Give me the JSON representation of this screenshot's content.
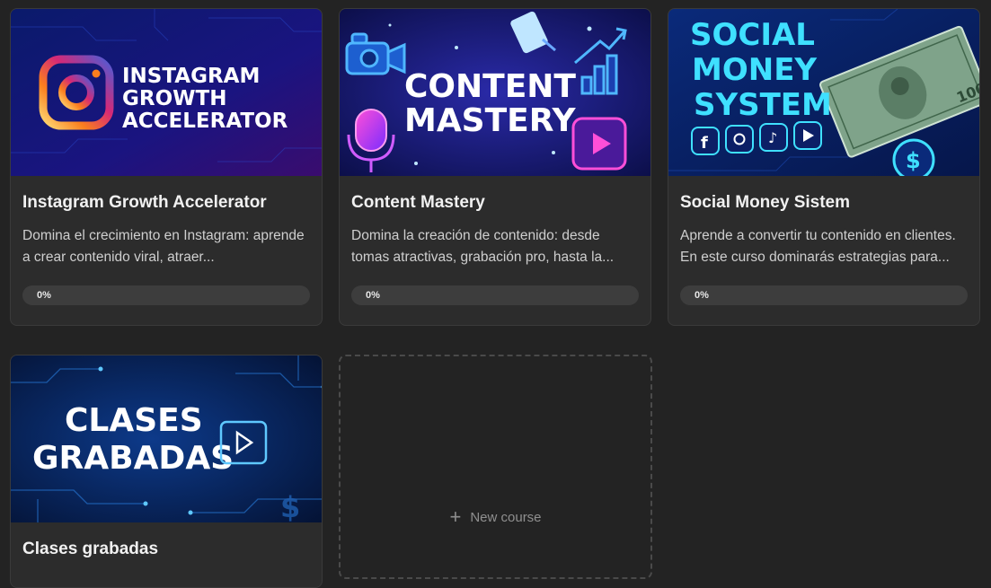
{
  "courses": [
    {
      "title": "Instagram Growth Accelerator",
      "description": "Domina el crecimiento en Instagram: aprende a crear contenido viral, atraer...",
      "progress_label": "0%",
      "progress": 0,
      "thumb_text": [
        "INSTAGRAM",
        "GROWTH",
        "ACCELERATOR"
      ]
    },
    {
      "title": "Content Mastery",
      "description": "Domina la creación de contenido: desde tomas atractivas, grabación pro, hasta la...",
      "progress_label": "0%",
      "progress": 0,
      "thumb_text": [
        "CONTENT",
        "MASTERY"
      ]
    },
    {
      "title": "Social Money Sistem",
      "description": "Aprende a convertir tu contenido en clientes. En este curso dominarás estrategias para...",
      "progress_label": "0%",
      "progress": 0,
      "thumb_text": [
        "SOCIAL",
        "MONEY",
        "SYSTEM"
      ]
    },
    {
      "title": "Clases grabadas",
      "thumb_text": [
        "CLASES",
        "GRABADAS"
      ]
    }
  ],
  "new_course": {
    "label": "New course",
    "icon": "plus-icon"
  },
  "colors": {
    "background": "#232323",
    "card": "#2c2c2c",
    "neon_cyan": "#3fe0ff",
    "neon_purple": "#8a3dff",
    "instagram_gradient": [
      "#feda75",
      "#fa7e1e",
      "#d62976",
      "#962fbf",
      "#4f5bd5"
    ]
  }
}
